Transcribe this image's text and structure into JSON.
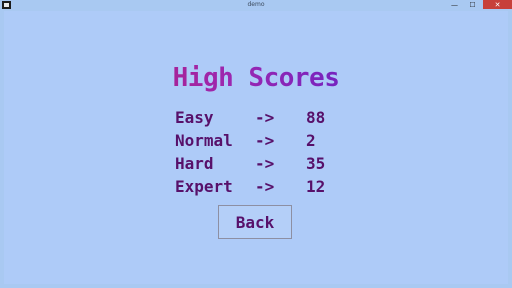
{
  "window": {
    "title": "demo",
    "minimize_glyph": "—",
    "maximize_glyph": "☐",
    "close_glyph": "✕"
  },
  "screen": {
    "heading": "High Scores",
    "scores": [
      {
        "level": "Easy",
        "arrow": "->",
        "score": "88"
      },
      {
        "level": "Normal",
        "arrow": "->",
        "score": "2"
      },
      {
        "level": "Hard",
        "arrow": "->",
        "score": "35"
      },
      {
        "level": "Expert",
        "arrow": "->",
        "score": "12"
      }
    ],
    "back_label": "Back"
  },
  "colors": {
    "background": "#aecbf8",
    "text": "#57106a",
    "heading_gradient": [
      "#c2185b",
      "#3b1fd6"
    ],
    "close_button": "#c7403a"
  }
}
